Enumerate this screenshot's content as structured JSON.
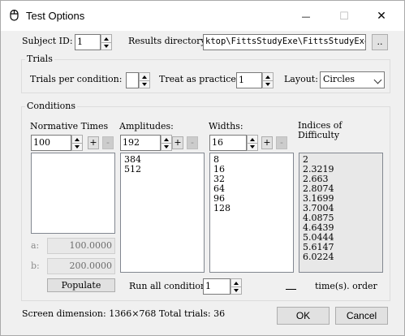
{
  "window": {
    "title": "Test Options",
    "minimize_glyph": "—",
    "maximize_glyph": "☐",
    "close_glyph": "✕"
  },
  "top": {
    "subject_id_label": "Subject ID:",
    "subject_id_value": "1",
    "results_dir_label": "Results directory:",
    "results_dir_value": "ktop\\FittsStudyExe\\FittsStudyExe",
    "browse_label": ".."
  },
  "trials": {
    "group_label": "Trials",
    "per_condition_label": "Trials per condition:",
    "per_condition_value": "",
    "practice_label": "Treat as practice:",
    "practice_value": "1",
    "layout_label": "Layout:",
    "layout_value": "Circles"
  },
  "conditions": {
    "group_label": "Conditions",
    "normative": {
      "header": "Normative Times",
      "value": "100",
      "add_label": "+",
      "remove_label": "-",
      "items": []
    },
    "amplitudes": {
      "header": "Amplitudes:",
      "value": "192",
      "add_label": "+",
      "remove_label": "-",
      "items": [
        "384",
        "512"
      ]
    },
    "widths": {
      "header": "Widths:",
      "value": "16",
      "add_label": "+",
      "remove_label": "-",
      "items": [
        "8",
        "16",
        "32",
        "64",
        "96",
        "128"
      ]
    },
    "indices": {
      "header_line1": "Indices of",
      "header_line2": "Difficulty",
      "items": [
        "2",
        "2.3219",
        "2.663",
        "2.8074",
        "3.1699",
        "3.7004",
        "4.0875",
        "4.6439",
        "5.0444",
        "5.6147",
        "6.0224"
      ]
    },
    "a_label": "a:",
    "a_value": "100.0000",
    "b_label": "b:",
    "b_value": "200.0000",
    "populate_label": "Populate",
    "run_all_label": "Run all conditions",
    "run_all_value": "1",
    "time_order_label": "time(s). order"
  },
  "footer": {
    "status": "Screen dimension: 1366×768 Total trials: 36",
    "ok_label": "OK",
    "cancel_label": "Cancel"
  }
}
